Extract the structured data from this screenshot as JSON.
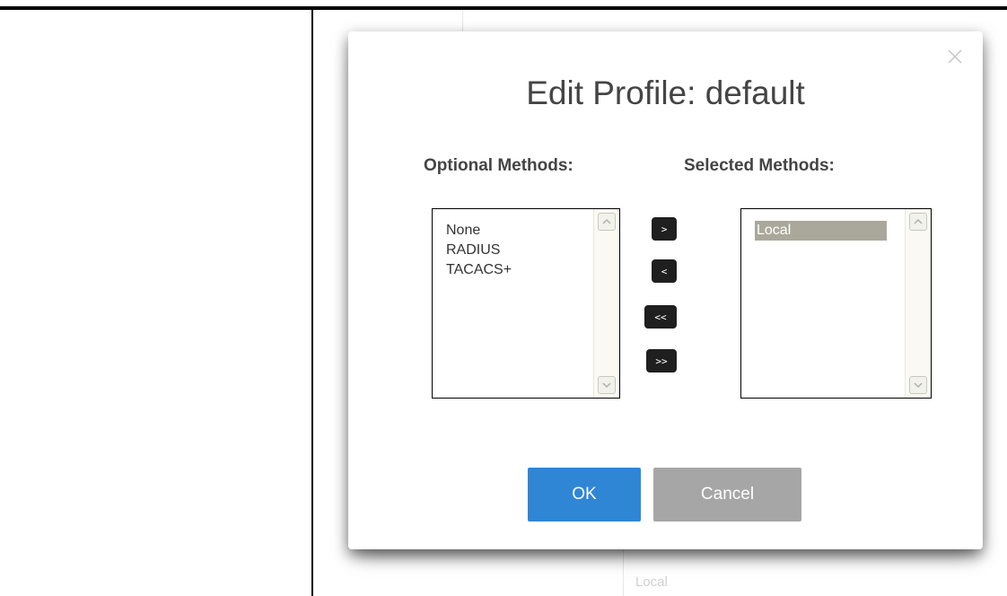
{
  "background": {
    "peek_text": "Local"
  },
  "dialog": {
    "title": "Edit Profile: default",
    "optional_label": "Optional Methods:",
    "selected_label": "Selected Methods:",
    "optional_methods": [
      "None",
      "RADIUS",
      "TACACS+"
    ],
    "selected_methods": [
      "Local"
    ],
    "selected_highlighted": "Local",
    "move_buttons": {
      "add": ">",
      "remove": "<",
      "remove_all": "<<",
      "add_all": ">>"
    },
    "ok_label": "OK",
    "cancel_label": "Cancel",
    "icons": [
      "close-icon",
      "scroll-up-icon",
      "scroll-down-icon"
    ]
  },
  "colors": {
    "ok_button": "#2f86d4",
    "cancel_button": "#a6a6a6",
    "move_button": "#1f1f1f",
    "selected_item": "#aaa89a"
  }
}
